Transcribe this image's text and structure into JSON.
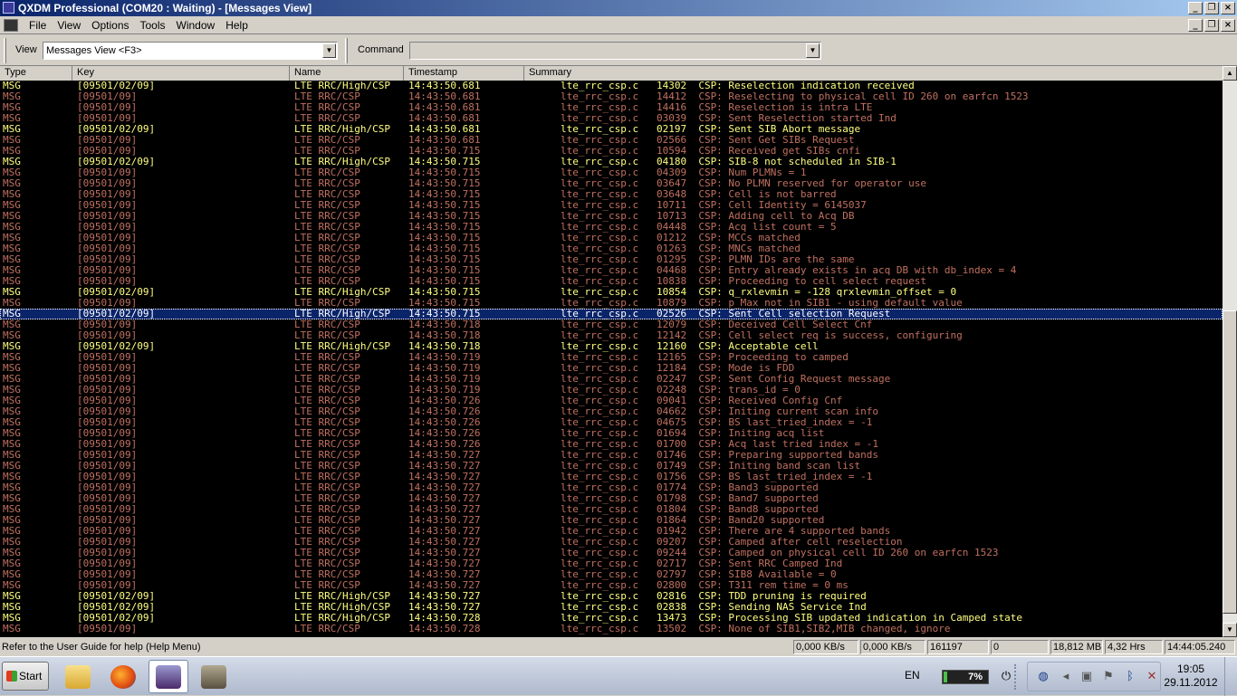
{
  "window": {
    "title": "QXDM Professional (COM20 : Waiting) - [Messages View]",
    "buttons": [
      "_",
      "❐",
      "×"
    ]
  },
  "menu": {
    "items": [
      "File",
      "View",
      "Options",
      "Tools",
      "Window",
      "Help"
    ]
  },
  "toolbar": {
    "view_label": "View",
    "view_value": "Messages View <F3>",
    "command_label": "Command",
    "command_value": ""
  },
  "columns": [
    "Type",
    "Key",
    "Name",
    "Timestamp",
    "Summary"
  ],
  "rows": [
    {
      "t": "MSG",
      "k": "[09501/02/09]",
      "n": "LTE RRC/High/CSP",
      "ts": "14:43:50.681",
      "s": "lte_rrc_csp.c   14302  CSP: Reselection indication received",
      "hi": true
    },
    {
      "t": "MSG",
      "k": "[09501/09]",
      "n": "LTE RRC/CSP",
      "ts": "14:43:50.681",
      "s": "lte_rrc_csp.c   14412  CSP: Reselecting to physical cell ID 260 on earfcn 1523"
    },
    {
      "t": "MSG",
      "k": "[09501/09]",
      "n": "LTE RRC/CSP",
      "ts": "14:43:50.681",
      "s": "lte_rrc_csp.c   14416  CSP: Reselection is intra LTE"
    },
    {
      "t": "MSG",
      "k": "[09501/09]",
      "n": "LTE RRC/CSP",
      "ts": "14:43:50.681",
      "s": "lte_rrc_csp.c   03039  CSP: Sent Reselection started Ind"
    },
    {
      "t": "MSG",
      "k": "[09501/02/09]",
      "n": "LTE RRC/High/CSP",
      "ts": "14:43:50.681",
      "s": "lte_rrc_csp.c   02197  CSP: Sent SIB Abort message",
      "hi": true
    },
    {
      "t": "MSG",
      "k": "[09501/09]",
      "n": "LTE RRC/CSP",
      "ts": "14:43:50.681",
      "s": "lte_rrc_csp.c   02566  CSP: Sent Get SIBs Request"
    },
    {
      "t": "MSG",
      "k": "[09501/09]",
      "n": "LTE RRC/CSP",
      "ts": "14:43:50.715",
      "s": "lte_rrc_csp.c   10594  CSP: Received get SIBs cnfi"
    },
    {
      "t": "MSG",
      "k": "[09501/02/09]",
      "n": "LTE RRC/High/CSP",
      "ts": "14:43:50.715",
      "s": "lte_rrc_csp.c   04180  CSP: SIB-8 not scheduled in SIB-1",
      "hi": true
    },
    {
      "t": "MSG",
      "k": "[09501/09]",
      "n": "LTE RRC/CSP",
      "ts": "14:43:50.715",
      "s": "lte_rrc_csp.c   04309  CSP: Num PLMNs = 1"
    },
    {
      "t": "MSG",
      "k": "[09501/09]",
      "n": "LTE RRC/CSP",
      "ts": "14:43:50.715",
      "s": "lte_rrc_csp.c   03647  CSP: No PLMN reserved for operator use"
    },
    {
      "t": "MSG",
      "k": "[09501/09]",
      "n": "LTE RRC/CSP",
      "ts": "14:43:50.715",
      "s": "lte_rrc_csp.c   03648  CSP: Cell is not barred"
    },
    {
      "t": "MSG",
      "k": "[09501/09]",
      "n": "LTE RRC/CSP",
      "ts": "14:43:50.715",
      "s": "lte_rrc_csp.c   10711  CSP: Cell Identity = 6145037"
    },
    {
      "t": "MSG",
      "k": "[09501/09]",
      "n": "LTE RRC/CSP",
      "ts": "14:43:50.715",
      "s": "lte_rrc_csp.c   10713  CSP: Adding cell to Acq DB"
    },
    {
      "t": "MSG",
      "k": "[09501/09]",
      "n": "LTE RRC/CSP",
      "ts": "14:43:50.715",
      "s": "lte_rrc_csp.c   04448  CSP: Acq list count = 5"
    },
    {
      "t": "MSG",
      "k": "[09501/09]",
      "n": "LTE RRC/CSP",
      "ts": "14:43:50.715",
      "s": "lte_rrc_csp.c   01212  CSP: MCCs matched"
    },
    {
      "t": "MSG",
      "k": "[09501/09]",
      "n": "LTE RRC/CSP",
      "ts": "14:43:50.715",
      "s": "lte_rrc_csp.c   01263  CSP: MNCs matched"
    },
    {
      "t": "MSG",
      "k": "[09501/09]",
      "n": "LTE RRC/CSP",
      "ts": "14:43:50.715",
      "s": "lte_rrc_csp.c   01295  CSP: PLMN IDs are the same"
    },
    {
      "t": "MSG",
      "k": "[09501/09]",
      "n": "LTE RRC/CSP",
      "ts": "14:43:50.715",
      "s": "lte_rrc_csp.c   04468  CSP: Entry already exists in acq DB with db_index = 4"
    },
    {
      "t": "MSG",
      "k": "[09501/09]",
      "n": "LTE RRC/CSP",
      "ts": "14:43:50.715",
      "s": "lte_rrc_csp.c   10838  CSP: Proceeding to cell select request"
    },
    {
      "t": "MSG",
      "k": "[09501/02/09]",
      "n": "LTE RRC/High/CSP",
      "ts": "14:43:50.715",
      "s": "lte_rrc_csp.c   10854  CSP: q_rxlevmin = -128 qrxlevmin_offset = 0",
      "hi": true
    },
    {
      "t": "MSG",
      "k": "[09501/09]",
      "n": "LTE RRC/CSP",
      "ts": "14:43:50.715",
      "s": "lte_rrc_csp.c   10879  CSP: p_Max not in SIB1 - using default value"
    },
    {
      "t": "MSG",
      "k": "[09501/02/09]",
      "n": "LTE RRC/High/CSP",
      "ts": "14:43:50.715",
      "s": "lte_rrc_csp.c   02526  CSP: Sent Cell selection Request",
      "sel": true
    },
    {
      "t": "MSG",
      "k": "[09501/09]",
      "n": "LTE RRC/CSP",
      "ts": "14:43:50.718",
      "s": "lte_rrc_csp.c   12079  CSP: Deceived Cell Select Cnf"
    },
    {
      "t": "MSG",
      "k": "[09501/09]",
      "n": "LTE RRC/CSP",
      "ts": "14:43:50.718",
      "s": "lte_rrc_csp.c   12142  CSP: Cell select req is success, configuring"
    },
    {
      "t": "MSG",
      "k": "[09501/02/09]",
      "n": "LTE RRC/High/CSP",
      "ts": "14:43:50.718",
      "s": "lte_rrc_csp.c   12160  CSP: Acceptable cell",
      "hi": true
    },
    {
      "t": "MSG",
      "k": "[09501/09]",
      "n": "LTE RRC/CSP",
      "ts": "14:43:50.719",
      "s": "lte_rrc_csp.c   12165  CSP: Proceeding to camped"
    },
    {
      "t": "MSG",
      "k": "[09501/09]",
      "n": "LTE RRC/CSP",
      "ts": "14:43:50.719",
      "s": "lte_rrc_csp.c   12184  CSP: Mode is FDD"
    },
    {
      "t": "MSG",
      "k": "[09501/09]",
      "n": "LTE RRC/CSP",
      "ts": "14:43:50.719",
      "s": "lte_rrc_csp.c   02247  CSP: Sent Config Request message"
    },
    {
      "t": "MSG",
      "k": "[09501/09]",
      "n": "LTE RRC/CSP",
      "ts": "14:43:50.719",
      "s": "lte_rrc_csp.c   02248  CSP: trans_id = 0"
    },
    {
      "t": "MSG",
      "k": "[09501/09]",
      "n": "LTE RRC/CSP",
      "ts": "14:43:50.726",
      "s": "lte_rrc_csp.c   09041  CSP: Received Config Cnf"
    },
    {
      "t": "MSG",
      "k": "[09501/09]",
      "n": "LTE RRC/CSP",
      "ts": "14:43:50.726",
      "s": "lte_rrc_csp.c   04662  CSP: Initing current scan info"
    },
    {
      "t": "MSG",
      "k": "[09501/09]",
      "n": "LTE RRC/CSP",
      "ts": "14:43:50.726",
      "s": "lte_rrc_csp.c   04675  CSP: BS last_tried_index = -1"
    },
    {
      "t": "MSG",
      "k": "[09501/09]",
      "n": "LTE RRC/CSP",
      "ts": "14:43:50.726",
      "s": "lte_rrc_csp.c   01694  CSP: Initing acq list"
    },
    {
      "t": "MSG",
      "k": "[09501/09]",
      "n": "LTE RRC/CSP",
      "ts": "14:43:50.726",
      "s": "lte_rrc_csp.c   01700  CSP: Acq last tried index = -1"
    },
    {
      "t": "MSG",
      "k": "[09501/09]",
      "n": "LTE RRC/CSP",
      "ts": "14:43:50.727",
      "s": "lte_rrc_csp.c   01746  CSP: Preparing supported bands"
    },
    {
      "t": "MSG",
      "k": "[09501/09]",
      "n": "LTE RRC/CSP",
      "ts": "14:43:50.727",
      "s": "lte_rrc_csp.c   01749  CSP: Initing band scan list"
    },
    {
      "t": "MSG",
      "k": "[09501/09]",
      "n": "LTE RRC/CSP",
      "ts": "14:43:50.727",
      "s": "lte_rrc_csp.c   01756  CSP: BS last_tried_index = -1"
    },
    {
      "t": "MSG",
      "k": "[09501/09]",
      "n": "LTE RRC/CSP",
      "ts": "14:43:50.727",
      "s": "lte_rrc_csp.c   01774  CSP: Band3 supported"
    },
    {
      "t": "MSG",
      "k": "[09501/09]",
      "n": "LTE RRC/CSP",
      "ts": "14:43:50.727",
      "s": "lte_rrc_csp.c   01798  CSP: Band7 supported"
    },
    {
      "t": "MSG",
      "k": "[09501/09]",
      "n": "LTE RRC/CSP",
      "ts": "14:43:50.727",
      "s": "lte_rrc_csp.c   01804  CSP: Band8 supported"
    },
    {
      "t": "MSG",
      "k": "[09501/09]",
      "n": "LTE RRC/CSP",
      "ts": "14:43:50.727",
      "s": "lte_rrc_csp.c   01864  CSP: Band20 supported"
    },
    {
      "t": "MSG",
      "k": "[09501/09]",
      "n": "LTE RRC/CSP",
      "ts": "14:43:50.727",
      "s": "lte_rrc_csp.c   01942  CSP: There are 4 supported bands"
    },
    {
      "t": "MSG",
      "k": "[09501/09]",
      "n": "LTE RRC/CSP",
      "ts": "14:43:50.727",
      "s": "lte_rrc_csp.c   09207  CSP: Camped after cell reselection"
    },
    {
      "t": "MSG",
      "k": "[09501/09]",
      "n": "LTE RRC/CSP",
      "ts": "14:43:50.727",
      "s": "lte_rrc_csp.c   09244  CSP: Camped on physical cell ID 260 on earfcn 1523"
    },
    {
      "t": "MSG",
      "k": "[09501/09]",
      "n": "LTE RRC/CSP",
      "ts": "14:43:50.727",
      "s": "lte_rrc_csp.c   02717  CSP: Sent RRC Camped Ind"
    },
    {
      "t": "MSG",
      "k": "[09501/09]",
      "n": "LTE RRC/CSP",
      "ts": "14:43:50.727",
      "s": "lte_rrc_csp.c   02797  CSP: SIB8 Available = 0"
    },
    {
      "t": "MSG",
      "k": "[09501/09]",
      "n": "LTE RRC/CSP",
      "ts": "14:43:50.727",
      "s": "lte_rrc_csp.c   02800  CSP: T311 rem time = 0 ms"
    },
    {
      "t": "MSG",
      "k": "[09501/02/09]",
      "n": "LTE RRC/High/CSP",
      "ts": "14:43:50.727",
      "s": "lte_rrc_csp.c   02816  CSP: TDD pruning is required",
      "hi": true
    },
    {
      "t": "MSG",
      "k": "[09501/02/09]",
      "n": "LTE RRC/High/CSP",
      "ts": "14:43:50.727",
      "s": "lte_rrc_csp.c   02838  CSP: Sending NAS Service Ind",
      "hi": true
    },
    {
      "t": "MSG",
      "k": "[09501/02/09]",
      "n": "LTE RRC/High/CSP",
      "ts": "14:43:50.728",
      "s": "lte_rrc_csp.c   13473  CSP: Processing SIB updated indication in Camped state",
      "hi": true
    },
    {
      "t": "MSG",
      "k": "[09501/09]",
      "n": "LTE RRC/CSP",
      "ts": "14:43:50.728",
      "s": "lte_rrc_csp.c   13502  CSP: None of SIB1,SIB2,MIB changed, ignore"
    }
  ],
  "status": {
    "help_text": "Refer to the User Guide for help (Help Menu)",
    "rx_rate": "0,000 KB/s",
    "tx_rate": "0,000 KB/s",
    "items": "161197",
    "errors": "0",
    "memory": "18,812 MB",
    "duration": "4,32 Hrs",
    "time": "14:44:05.240"
  },
  "taskbar": {
    "start_label": "Start",
    "apps": [
      "file-explorer-icon",
      "firefox-icon",
      "qxdm-icon",
      "gimp-icon"
    ],
    "language": "EN",
    "battery": "7%",
    "battery_level": 0.07,
    "clock_time": "19:05",
    "clock_date": "29.11.2012"
  }
}
